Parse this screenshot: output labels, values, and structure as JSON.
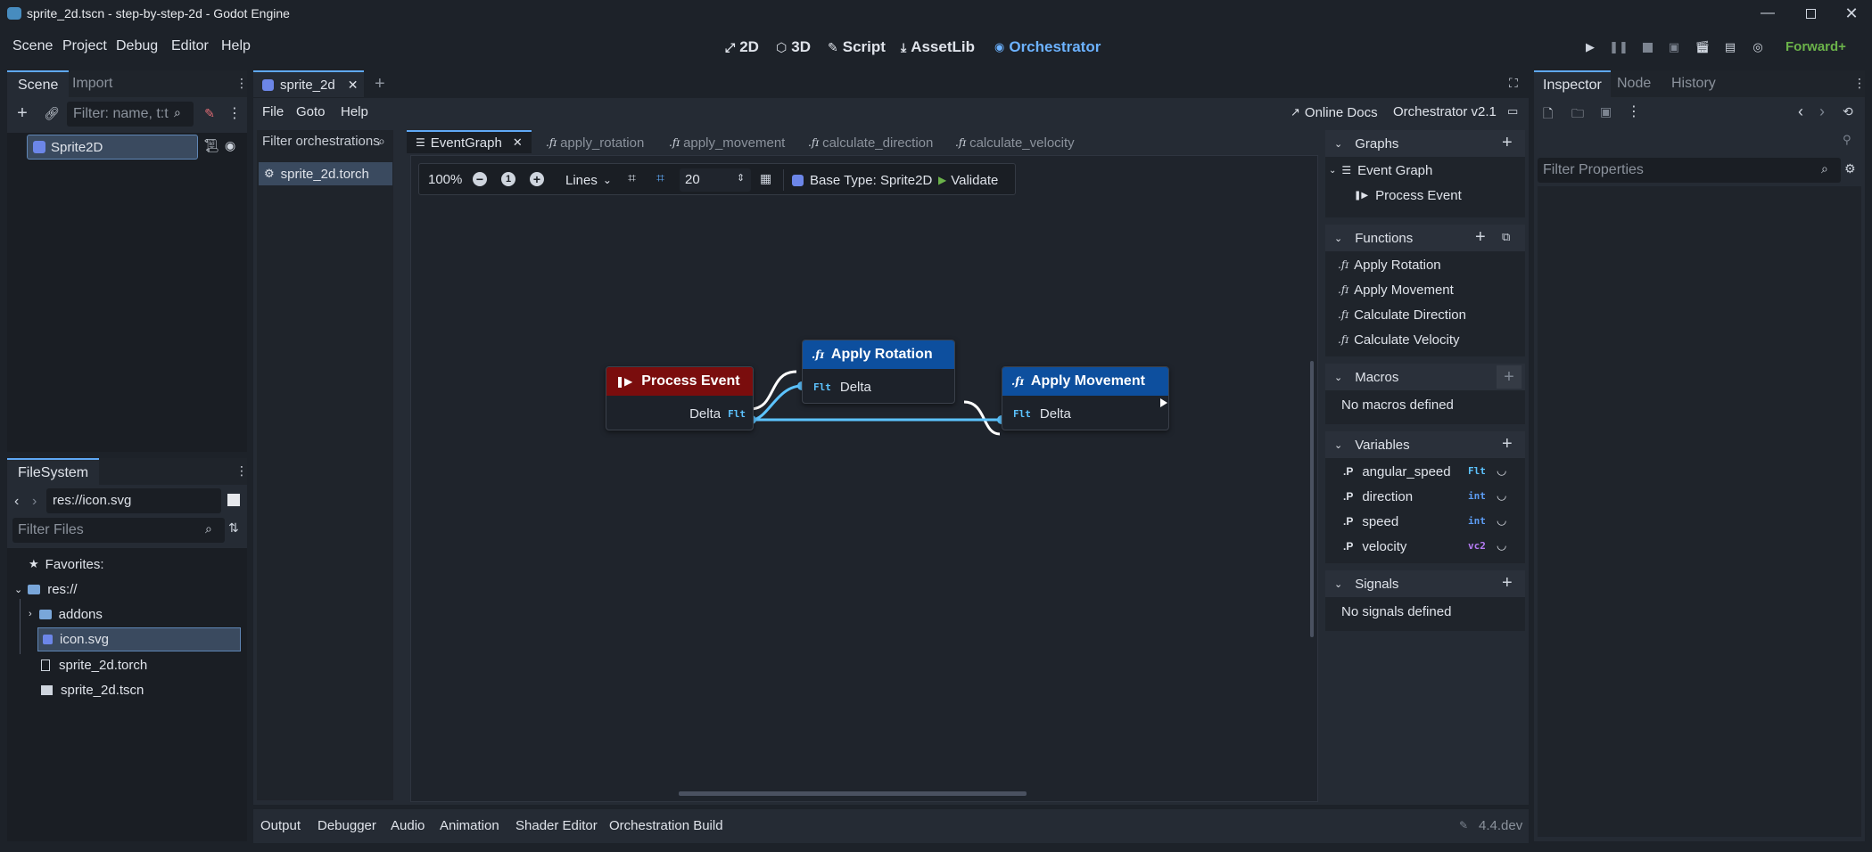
{
  "window": {
    "title": "sprite_2d.tscn - step-by-step-2d - Godot Engine"
  },
  "menu": {
    "items": [
      "Scene",
      "Project",
      "Debug",
      "Editor",
      "Help"
    ]
  },
  "workspaces": {
    "d2": "2D",
    "d3": "3D",
    "script": "Script",
    "assetlib": "AssetLib",
    "orchestrator": "Orchestrator"
  },
  "renderer": "Forward+",
  "scene_dock": {
    "tabs": [
      "Scene",
      "Import"
    ],
    "filter_placeholder": "Filter: name, t:t",
    "root_node": "Sprite2D"
  },
  "filesystem": {
    "title": "FileSystem",
    "path": "res://icon.svg",
    "filter_placeholder": "Filter Files",
    "favorites": "Favorites:",
    "root": "res://",
    "items": [
      "addons",
      "icon.svg",
      "sprite_2d.torch",
      "sprite_2d.tscn"
    ]
  },
  "editor_tabs": {
    "active": "sprite_2d"
  },
  "orch_menu": {
    "file": "File",
    "goto": "Goto",
    "help": "Help",
    "online_docs": "Online Docs",
    "version": "Orchestrator v2.1"
  },
  "orch_list": {
    "filter_placeholder": "Filter orchestrations",
    "items": [
      "sprite_2d.torch"
    ]
  },
  "graph_tabs": [
    "EventGraph",
    "apply_rotation",
    "apply_movement",
    "calculate_direction",
    "calculate_velocity"
  ],
  "graph_toolbar": {
    "zoom": "100%",
    "lines": "Lines",
    "grid": "20",
    "base_type": "Base Type: Sprite2D",
    "validate": "Validate"
  },
  "nodes": {
    "process_event": {
      "title": "Process Event",
      "pin": "Delta",
      "type": "Flt",
      "color": "#7a0d0d"
    },
    "apply_rotation": {
      "title": "Apply Rotation",
      "pin": "Delta",
      "type": "Flt",
      "color": "#0d4f9e"
    },
    "apply_movement": {
      "title": "Apply Movement",
      "pin": "Delta",
      "type": "Flt",
      "color": "#0d4f9e"
    }
  },
  "components": {
    "graphs": {
      "title": "Graphs",
      "items": [
        "Event Graph",
        "Process Event"
      ]
    },
    "functions": {
      "title": "Functions",
      "items": [
        "Apply Rotation",
        "Apply Movement",
        "Calculate Direction",
        "Calculate Velocity"
      ]
    },
    "macros": {
      "title": "Macros",
      "empty": "No macros defined"
    },
    "variables": {
      "title": "Variables",
      "items": [
        {
          "name": "angular_speed",
          "type": "Flt"
        },
        {
          "name": "direction",
          "type": "int"
        },
        {
          "name": "speed",
          "type": "int"
        },
        {
          "name": "velocity",
          "type": "vc2"
        }
      ]
    },
    "signals": {
      "title": "Signals",
      "empty": "No signals defined"
    }
  },
  "inspector": {
    "tabs": [
      "Inspector",
      "Node",
      "History"
    ],
    "filter_placeholder": "Filter Properties"
  },
  "bottom": {
    "tabs": [
      "Output",
      "Debugger",
      "Audio",
      "Animation",
      "Shader Editor",
      "Orchestration Build"
    ],
    "version": "4.4.dev"
  },
  "colors": {
    "accent": "#5fa8f5",
    "exec_red": "#7a0d0d",
    "func_blue": "#0d4f9e",
    "float_pin": "#5cc3ff"
  }
}
